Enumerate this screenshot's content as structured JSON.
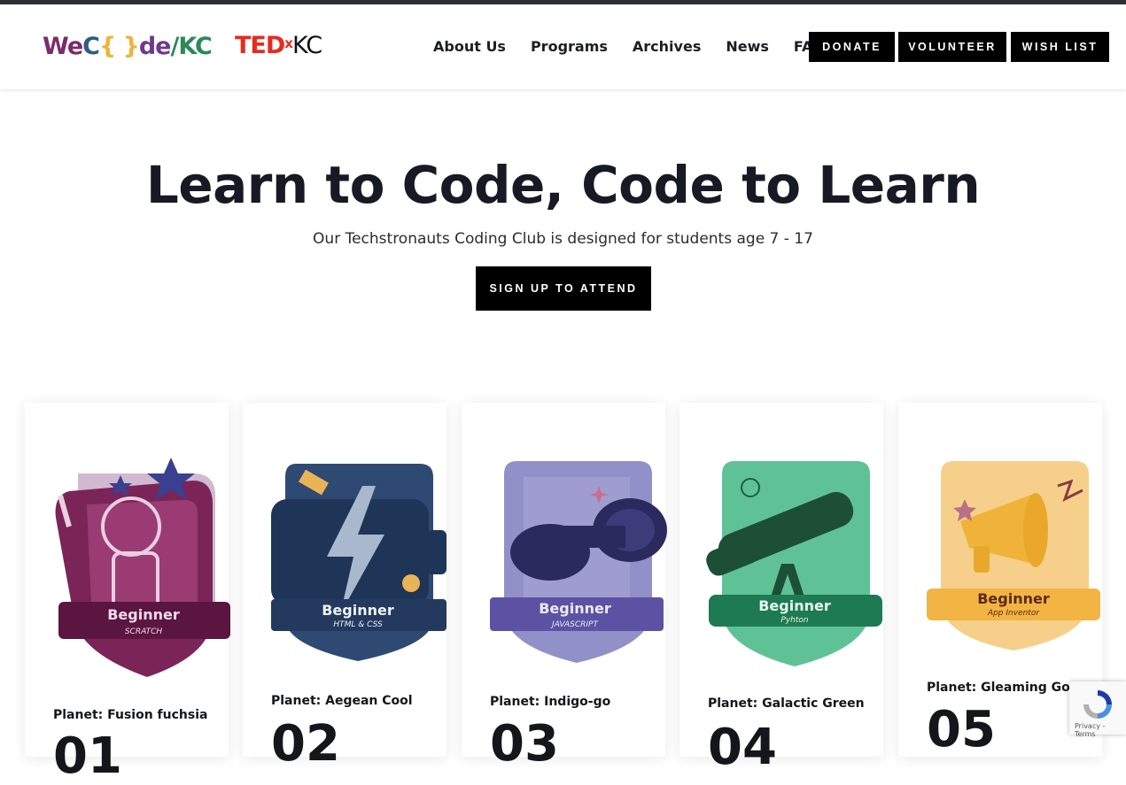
{
  "header": {
    "logo_wecode": {
      "we": "We",
      "c": "C",
      "brace": "{ }",
      "de": "de",
      "slash_kc": "/KC"
    },
    "logo_ted": {
      "ted": "TED",
      "x": "x",
      "kc": "KC"
    },
    "nav": [
      "About Us",
      "Programs",
      "Archives",
      "News",
      "FAQ"
    ],
    "buttons": {
      "donate": "DONATE",
      "volunteer": "VOLUNTEER",
      "wishlist": "WISH LIST"
    }
  },
  "hero": {
    "title": "Learn to Code, Code to Learn",
    "subtitle": "Our Techstronauts Coding Club is designed for students age 7 - 17",
    "cta": "SIGN UP TO ATTEND"
  },
  "cards": [
    {
      "badge_level": "Beginner",
      "badge_lang": "SCRATCH",
      "planet": "Planet: Fusion fuchsia",
      "number": "01",
      "color": "#7b2458"
    },
    {
      "badge_level": "Beginner",
      "badge_lang": "HTML & CSS",
      "planet": "Planet: Aegean Cool",
      "number": "02",
      "color": "#23395e"
    },
    {
      "badge_level": "Beginner",
      "badge_lang": "JAVASCRIPT",
      "planet": "Planet: Indigo-go",
      "number": "03",
      "color": "#5b52a3"
    },
    {
      "badge_level": "Beginner",
      "badge_lang": "Pyhton",
      "planet": "Planet: Galactic Green",
      "number": "04",
      "color": "#1d7a52"
    },
    {
      "badge_level": "Beginner",
      "badge_lang": "App Inventor",
      "planet": "Planet: Gleaming Gold",
      "number": "05",
      "color": "#f2b443"
    }
  ],
  "recaptcha": {
    "links": "Privacy - Terms"
  }
}
